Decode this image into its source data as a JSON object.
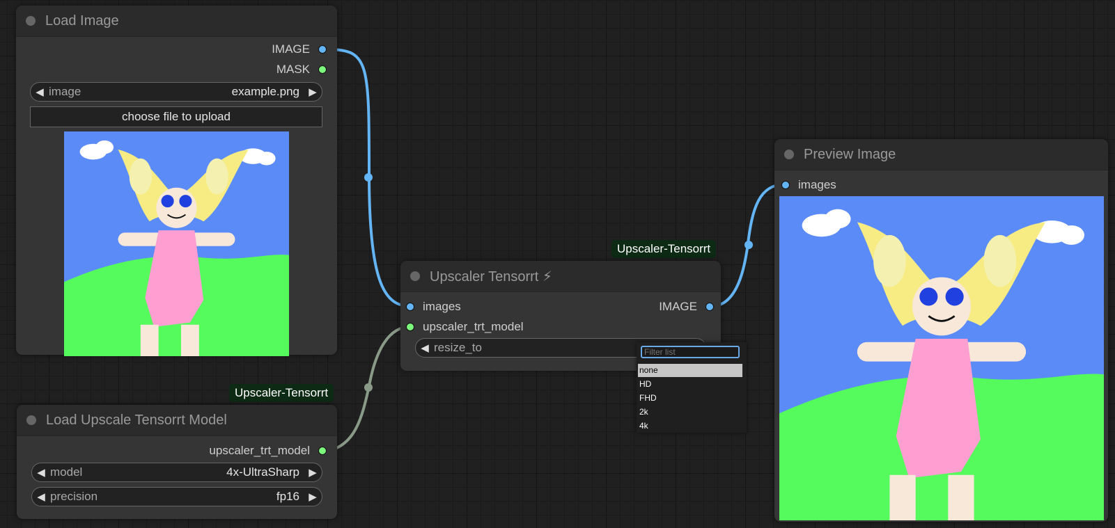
{
  "colors": {
    "image_link": "#64b5f6",
    "model_link": "#8a9a88",
    "badge_bg": "#0d2a15"
  },
  "load_image": {
    "title": "Load Image",
    "outputs": [
      "IMAGE",
      "MASK"
    ],
    "image_widget": {
      "name": "image",
      "value": "example.png"
    },
    "upload_button": "choose file to upload"
  },
  "load_model": {
    "badge": "Upscaler-Tensorrt",
    "title": "Load Upscale Tensorrt Model",
    "output": "upscaler_trt_model",
    "model_widget": {
      "name": "model",
      "value": "4x-UltraSharp"
    },
    "precision_widget": {
      "name": "precision",
      "value": "fp16"
    }
  },
  "upscaler": {
    "badge": "Upscaler-Tensorrt",
    "title": "Upscaler Tensorrt ⚡",
    "inputs": [
      "images",
      "upscaler_trt_model"
    ],
    "output": "IMAGE",
    "resize_widget": {
      "name": "resize_to"
    }
  },
  "preview": {
    "title": "Preview Image",
    "input": "images"
  },
  "dropdown": {
    "placeholder": "Filter list",
    "options": [
      "none",
      "HD",
      "FHD",
      "2k",
      "4k"
    ],
    "selected": "none"
  },
  "arrows": {
    "left": "◀",
    "right": "▶"
  }
}
